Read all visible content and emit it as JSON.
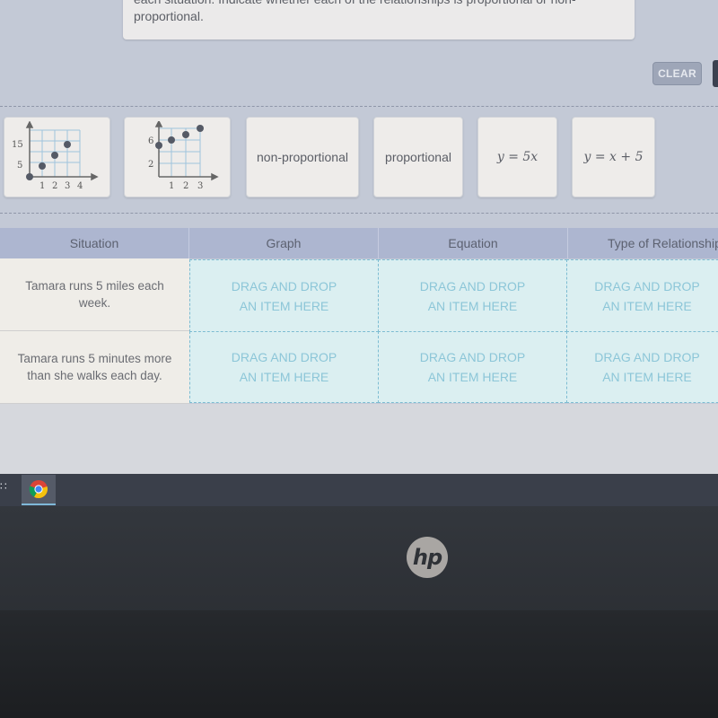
{
  "instructions": {
    "line1": "each situation. Indicate whether each of the relationships is proportional or non-",
    "line2": "proportional."
  },
  "toolbar": {
    "clear_label": "CLEAR"
  },
  "item_bank": {
    "items": [
      {
        "type": "graph",
        "name": "graph-proportional",
        "y_ticks": [
          "15",
          "5"
        ],
        "x_ticks": [
          "1",
          "2",
          "3",
          "4"
        ],
        "points": [
          [
            0,
            0
          ],
          [
            1,
            5
          ],
          [
            2,
            10
          ],
          [
            3,
            15
          ]
        ]
      },
      {
        "type": "graph",
        "name": "graph-non-proportional",
        "y_ticks": [
          "6",
          "2"
        ],
        "x_ticks": [
          "1",
          "2",
          "3"
        ],
        "points": [
          [
            0,
            5
          ],
          [
            1,
            6
          ],
          [
            2,
            7
          ],
          [
            3,
            8
          ]
        ]
      },
      {
        "type": "text",
        "label": "non-proportional"
      },
      {
        "type": "text",
        "label": "proportional"
      },
      {
        "type": "math",
        "label": "y = 5x"
      },
      {
        "type": "math",
        "label": "y = x + 5"
      }
    ]
  },
  "table": {
    "headers": [
      "Situation",
      "Graph",
      "Equation",
      "Type of Relationship"
    ],
    "rows": [
      {
        "situation": "Tamara runs 5 miles each week."
      },
      {
        "situation": "Tamara runs 5 minutes more than she walks each day."
      }
    ],
    "drop_line1": "DRAG AND DROP",
    "drop_line2": "AN ITEM HERE"
  },
  "taskbar": {
    "apps": [
      {
        "name": "Google Chrome",
        "icon": "chrome-icon"
      }
    ]
  },
  "device": {
    "brand": "hp"
  }
}
